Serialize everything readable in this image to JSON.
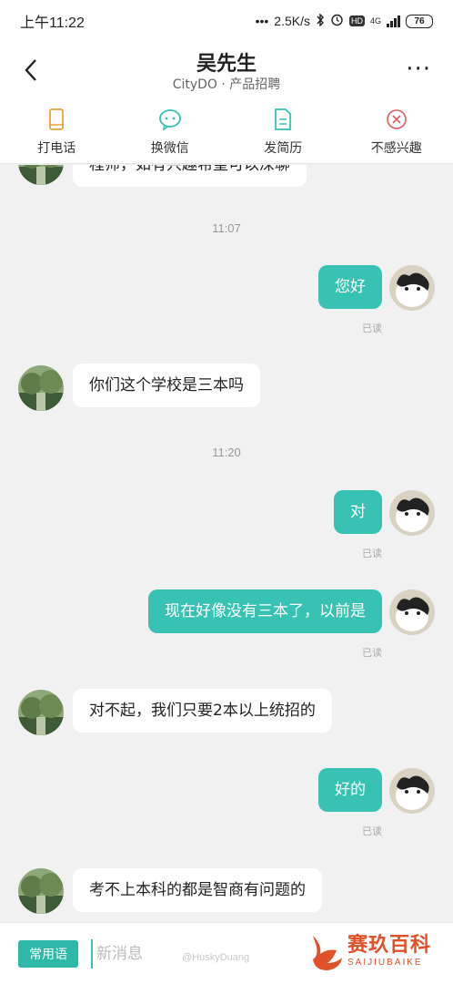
{
  "status_bar": {
    "time": "上午11:22",
    "net_speed": "2.5K/s",
    "network": "4G",
    "battery": "76"
  },
  "header": {
    "title": "吴先生",
    "subtitle": "CityDO · 产品招聘"
  },
  "actions": [
    {
      "label": "打电话",
      "icon": "phone-icon",
      "color": "#e8a33c"
    },
    {
      "label": "换微信",
      "icon": "wechat-icon",
      "color": "#38c2b3"
    },
    {
      "label": "发简历",
      "icon": "resume-icon",
      "color": "#38c2b3"
    },
    {
      "label": "不感兴趣",
      "icon": "not-interested-icon",
      "color": "#e05a5a"
    }
  ],
  "messages": {
    "partial_top": "程师，如有兴趣希望可以深聊",
    "time_1": "11:07",
    "m1": "您好",
    "m1_status": "已读",
    "m2": "你们这个学校是三本吗",
    "time_2": "11:20",
    "m3": "对",
    "m3_status": "已读",
    "m4": "现在好像没有三本了，以前是",
    "m4_status": "已读",
    "m5": "对不起，我们只要2本以上统招的",
    "m6": "好的",
    "m6_status": "已读",
    "m7": "考不上本科的都是智商有问题的"
  },
  "input_bar": {
    "phrase_button": "常用语",
    "placeholder": "新消息"
  },
  "watermark": {
    "weibo": "@HuskyDuang",
    "brand_cn": "赛玖百科",
    "brand_en": "SAIJIUBAIKE"
  },
  "colors": {
    "accent": "#38c2b3",
    "background": "#f1f1f1"
  }
}
